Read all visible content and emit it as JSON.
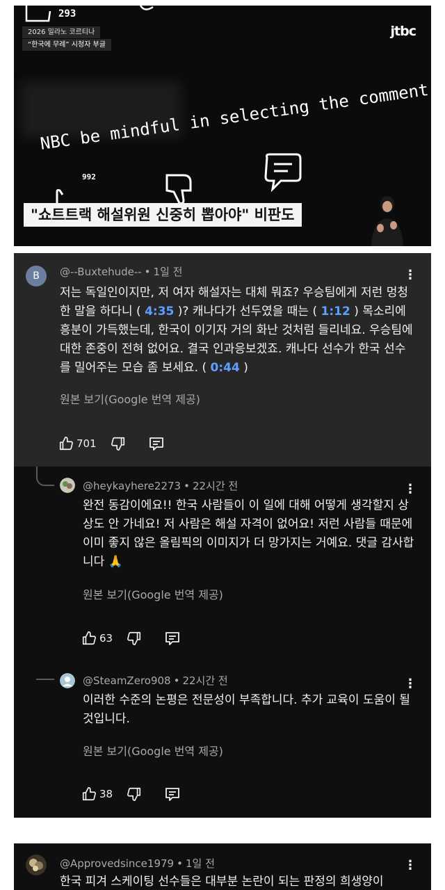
{
  "video": {
    "tag_line1": "2026 밀라노 코르티나",
    "tag_line2": "“한국에 무례” 시청자 부글",
    "channel_logo": "jtbc",
    "deco_number_top": "293",
    "deco_number_bottom": "992",
    "caption": "NBC be mindful in selecting the comment",
    "headline": "\"쇼트트랙 해설위원 신중히 뽑아야\" 비판도"
  },
  "comments": [
    {
      "author": "@--Buxtehude--",
      "time": "1일 전",
      "avatar_letter": "B",
      "body_parts": [
        "저는 독일인이지만, 저 여자 해설자는 대체 뭐죠? 우승팀에게 저런 멍청한 말을 하다니 ( ",
        "4:35",
        " )? 캐나다가 선두였을 때는 ( ",
        "1:12",
        " ) 목소리에 흥분이 가득했는데, 한국이 이기자 거의 화난 것처럼 들리네요. 우승팀에 대한 존중이 전혀 없어요. 결국 인과응보겠죠. 캐나다 선수가 한국 선수를 밀어주는 모습 좀 보세요. ( ",
        "0:44",
        " )"
      ],
      "translation_note": "원본 보기(Google 번역 제공)",
      "likes": "701"
    },
    {
      "author": "@heykayhere2273",
      "time": "22시간 전",
      "body": "완전 동감이에요!! 한국 사람들이 이 일에 대해 어떻게 생각할지 상상도 안 가네요! 저 사람은 해설 자격이 없어요! 저런 사람들 때문에 이미 좋지 않은 올림픽의 이미지가 더 망가지는 거예요. 댓글 감사합니다 🙏",
      "translation_note": "원본 보기(Google 번역 제공)",
      "likes": "63"
    },
    {
      "author": "@SteamZero908",
      "time": "22시간 전",
      "body": "이러한 수준의 논평은 전문성이 부족합니다. 추가 교육이 도움이 될 것입니다.",
      "translation_note": "원본 보기(Google 번역 제공)",
      "likes": "38"
    },
    {
      "author": "@Approvedsince1979",
      "time": "1일 전",
      "body": "한국 피겨 스케이팅 선수들은 대부분 논란이 되는 판정의 희생양이"
    }
  ],
  "colors": {
    "timestamp_link": "#5f9fff",
    "highlight_bg": "#272727",
    "thread_bg": "#0f0f0f"
  },
  "icons": [
    "thumbs-up-icon",
    "thumbs-down-icon",
    "reply-icon",
    "more-vert-icon"
  ]
}
